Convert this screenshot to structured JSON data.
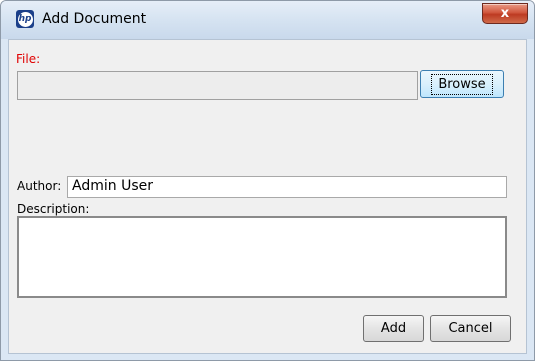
{
  "window": {
    "title": "Add Document",
    "app_icon_text": "hp",
    "close_glyph": "x"
  },
  "form": {
    "file_label": "File:",
    "file_value": "",
    "browse_label": "Browse",
    "author_label": "Author:",
    "author_value": "Admin User",
    "description_label": "Description:",
    "description_value": ""
  },
  "buttons": {
    "add_label": "Add",
    "cancel_label": "Cancel"
  },
  "colors": {
    "required_label": "#e00000",
    "dialog_background": "#f0f0f0",
    "close_button": "#c9442b"
  }
}
